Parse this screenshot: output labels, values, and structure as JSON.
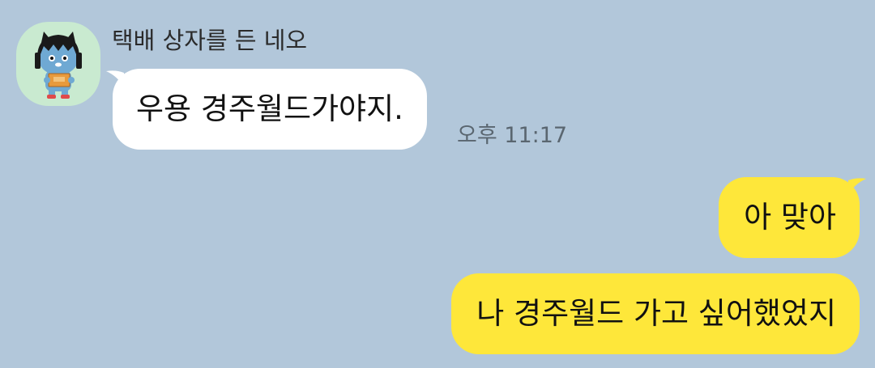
{
  "chat": {
    "sender_name": "택배 상자를 든 네오",
    "incoming": {
      "text": "우용 경주월드가야지.",
      "time": "오후 11:17"
    },
    "outgoing": [
      {
        "text": "아 맞아"
      },
      {
        "text": "나 경주월드 가고 싶어했었지"
      }
    ]
  },
  "colors": {
    "background": "#b2c7da",
    "incoming_bubble": "#ffffff",
    "outgoing_bubble": "#fee73a",
    "avatar_bg": "#c9ead0"
  },
  "icons": {
    "avatar": "neo-character-holding-box-icon"
  }
}
